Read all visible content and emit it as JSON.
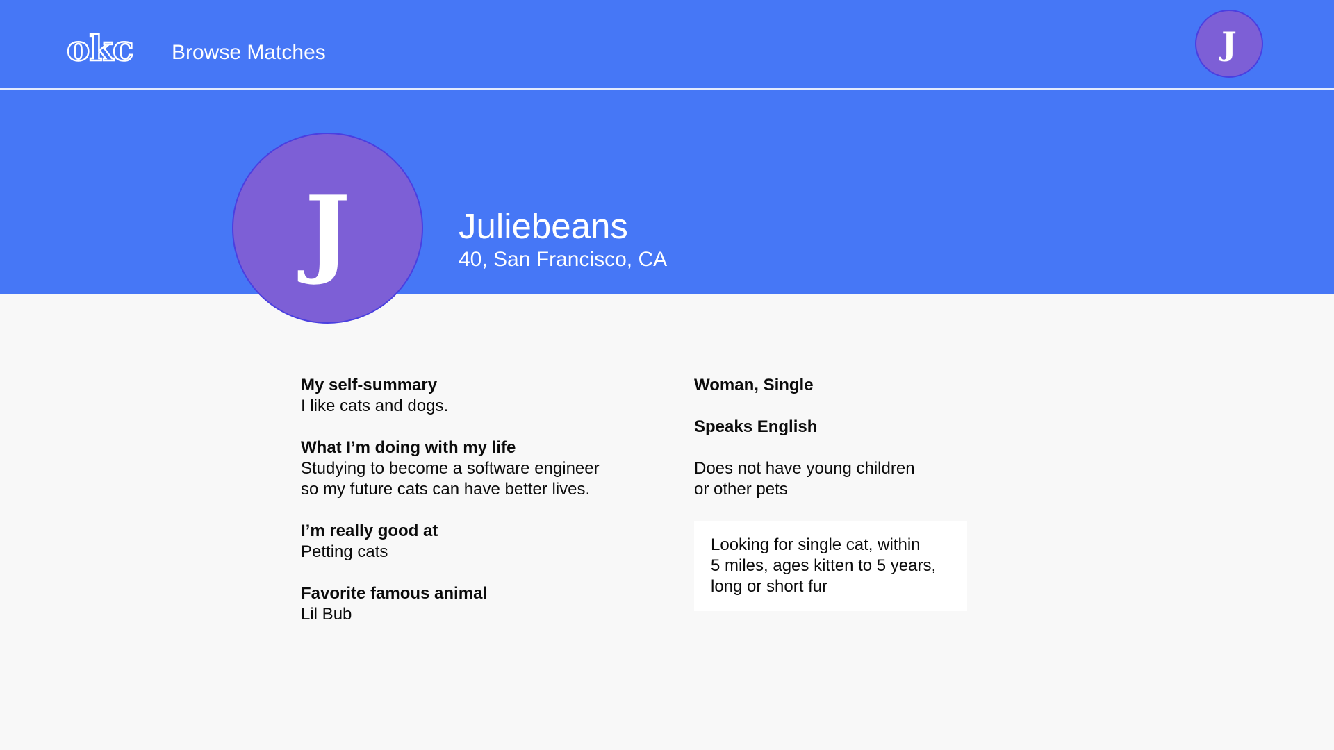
{
  "navbar": {
    "logo": "okc",
    "browse_label": "Browse Matches",
    "user_initial": "J"
  },
  "profile": {
    "initial": "J",
    "username": "Juliebeans",
    "age_location": "40, San Francisco, CA"
  },
  "essays": [
    {
      "title": "My self-summary",
      "body": "I like cats and dogs."
    },
    {
      "title": "What I’m doing with my life",
      "body": "Studying to become a software engineer\nso my future cats can have better lives."
    },
    {
      "title": "I’m really good at",
      "body": "Petting cats"
    },
    {
      "title": "Favorite famous animal",
      "body": "Lil Bub"
    }
  ],
  "details": {
    "gender_status": "Woman, Single",
    "languages": "Speaks English",
    "children_pets": "Does not have young children\nor other pets",
    "looking_for": "Looking for single cat, within\n5 miles, ages kitten to 5 years,\nlong or short fur"
  },
  "colors": {
    "brand_blue": "#4677f6",
    "avatar_purple": "#7d5fd6",
    "background": "#f8f8f8"
  }
}
